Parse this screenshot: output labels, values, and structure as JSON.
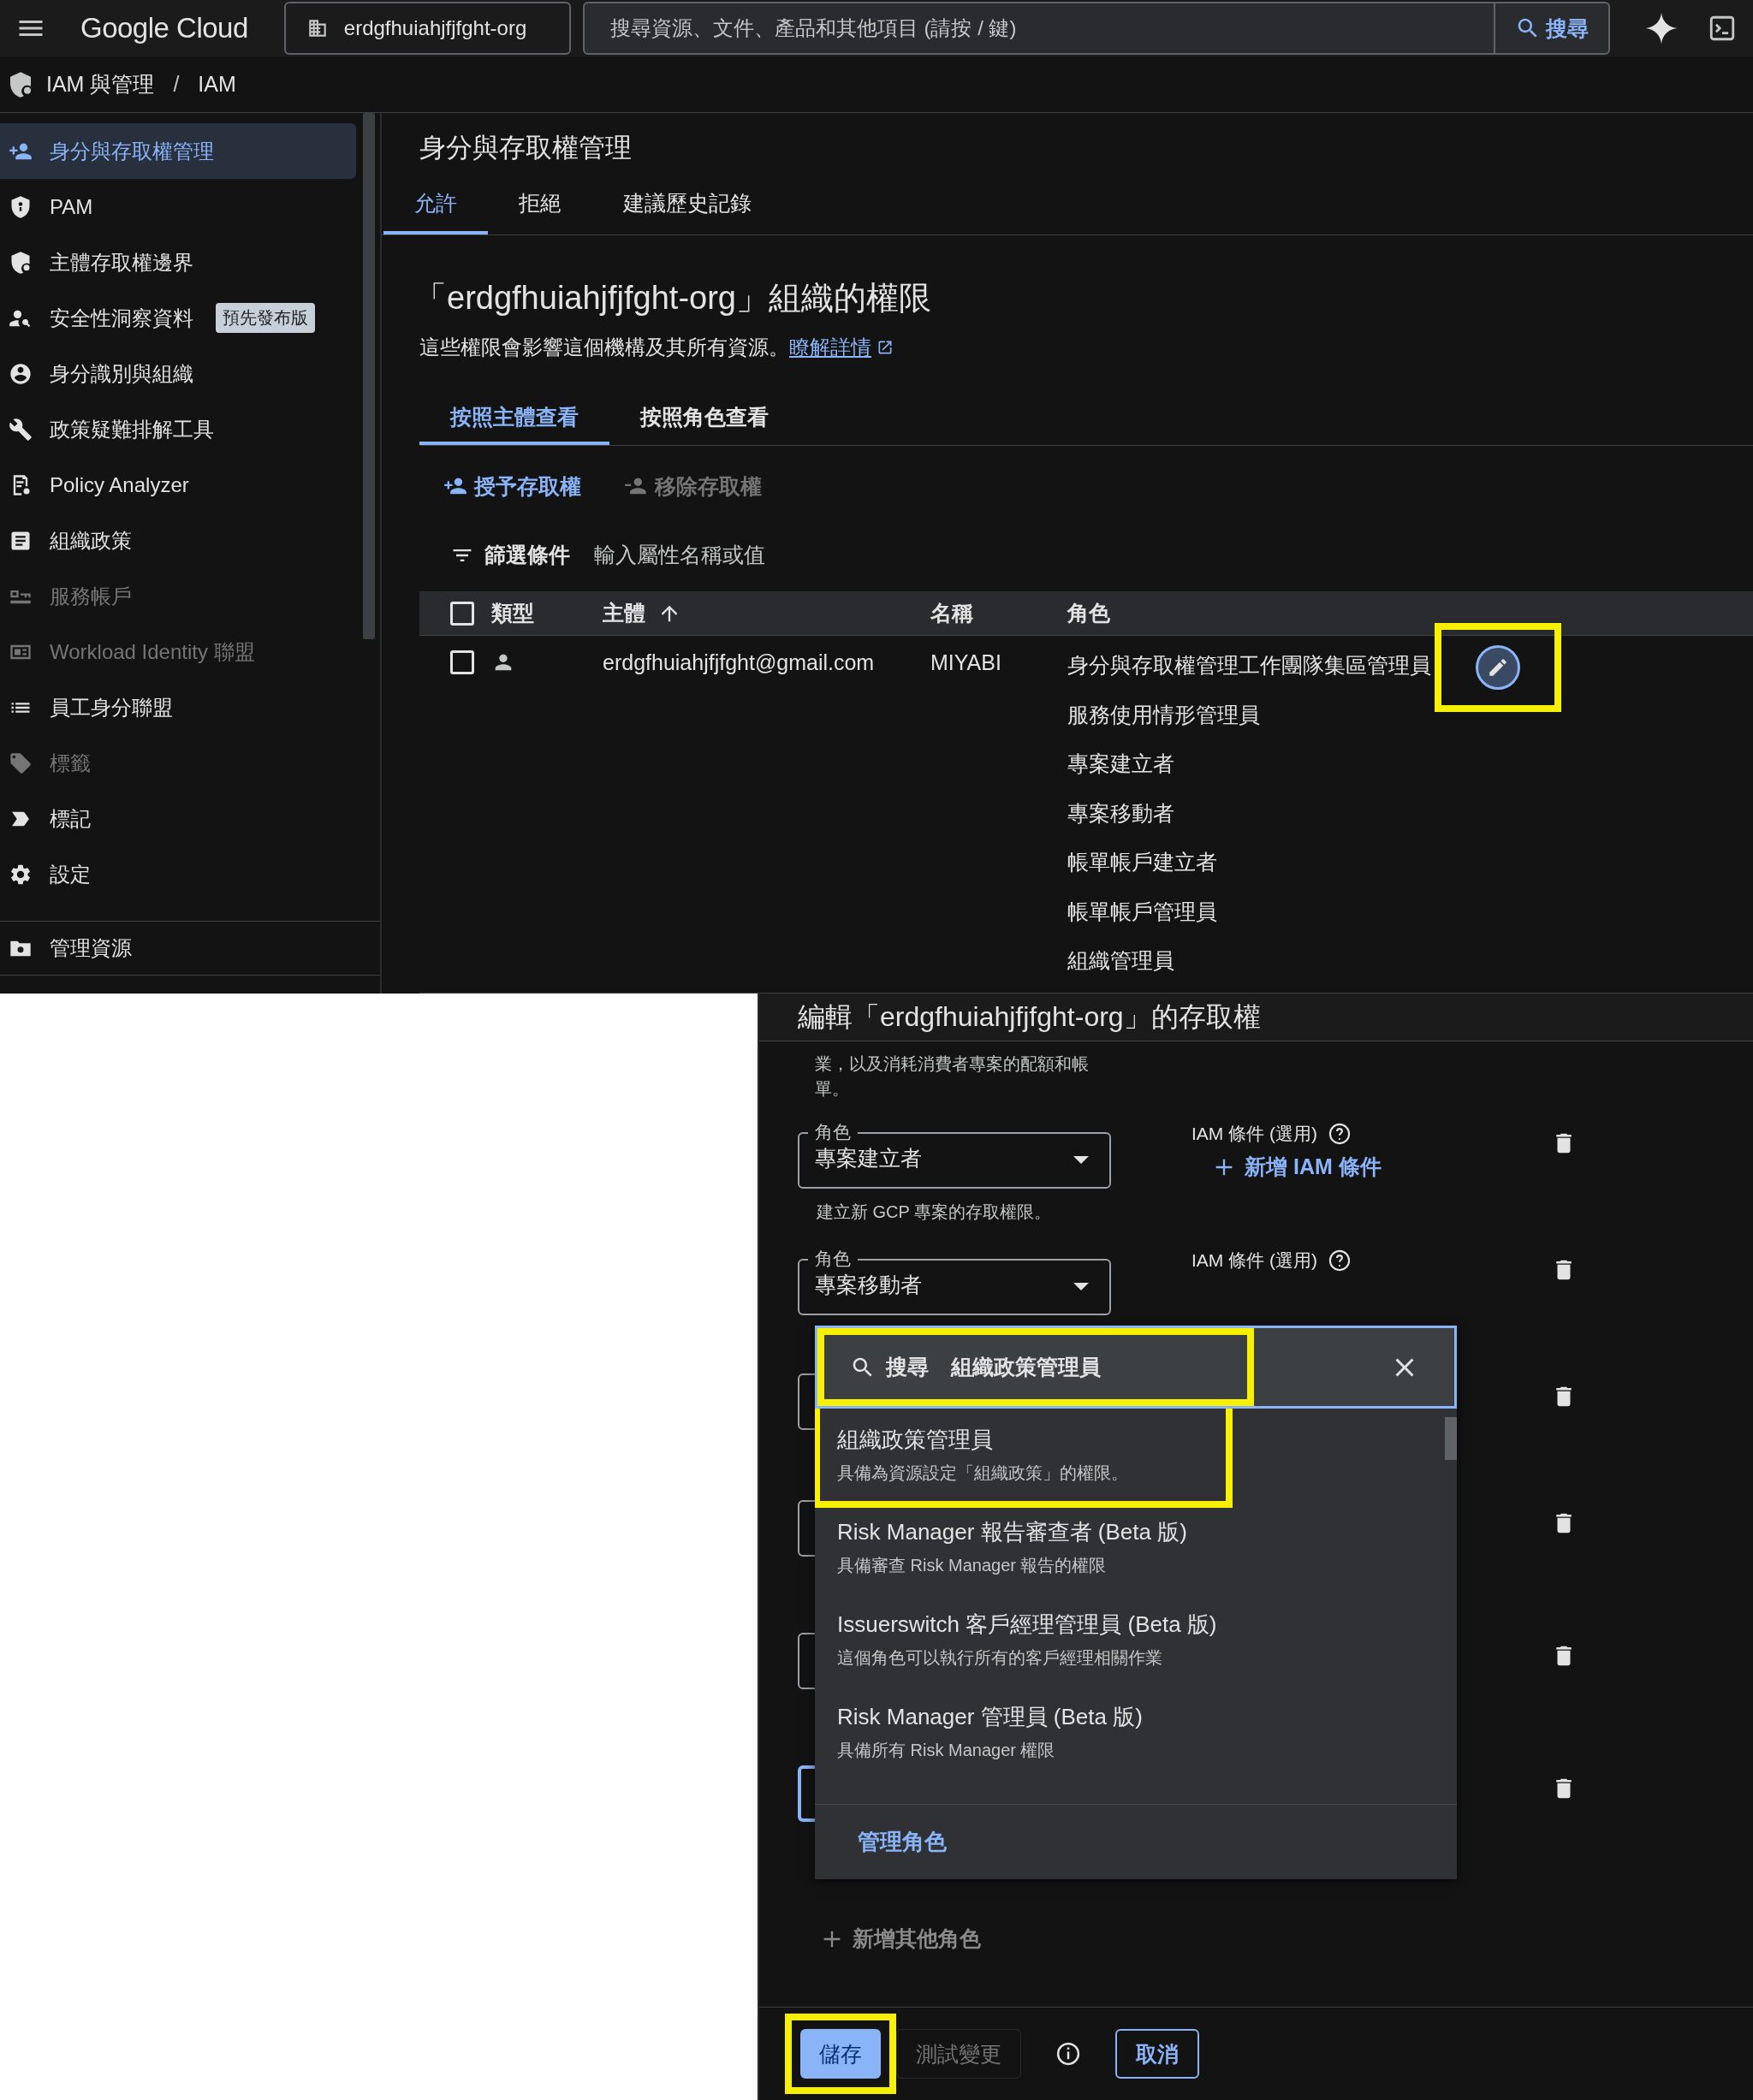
{
  "topbar": {
    "product": "Google Cloud",
    "project": "erdgfhuiahjfjfght-org",
    "search_placeholder": "搜尋資源、文件、產品和其他項目 (請按 / 鍵)",
    "search_button": "搜尋"
  },
  "breadcrumb": {
    "items": [
      "IAM 與管理",
      "IAM"
    ],
    "separator": "/"
  },
  "sidebar": {
    "items": [
      {
        "label": "身分與存取權管理",
        "selected": true,
        "disabled": false
      },
      {
        "label": "PAM",
        "selected": false,
        "disabled": false
      },
      {
        "label": "主體存取權邊界",
        "selected": false,
        "disabled": false
      },
      {
        "label": "安全性洞察資料",
        "selected": false,
        "disabled": false,
        "badge": "預先發布版"
      },
      {
        "label": "身分識別與組織",
        "selected": false,
        "disabled": false
      },
      {
        "label": "政策疑難排解工具",
        "selected": false,
        "disabled": false
      },
      {
        "label": "Policy Analyzer",
        "selected": false,
        "disabled": false
      },
      {
        "label": "組織政策",
        "selected": false,
        "disabled": false
      },
      {
        "label": "服務帳戶",
        "selected": false,
        "disabled": true
      },
      {
        "label": "Workload Identity 聯盟",
        "selected": false,
        "disabled": true
      },
      {
        "label": "員工身分聯盟",
        "selected": false,
        "disabled": false
      },
      {
        "label": "標籤",
        "selected": false,
        "disabled": true
      },
      {
        "label": "標記",
        "selected": false,
        "disabled": false
      },
      {
        "label": "設定",
        "selected": false,
        "disabled": false
      }
    ],
    "footer": "管理資源"
  },
  "page": {
    "title": "身分與存取權管理",
    "tabs": [
      {
        "label": "允許",
        "selected": true
      },
      {
        "label": "拒絕",
        "selected": false
      },
      {
        "label": "建議歷史記錄",
        "selected": false
      }
    ],
    "heading": "「erdgfhuiahjfjfght-org」組織的權限",
    "description": "這些權限會影響這個機構及其所有資源。",
    "learn_more": "瞭解詳情",
    "view_tabs": [
      {
        "label": "按照主體查看",
        "selected": true
      },
      {
        "label": "按照角色查看",
        "selected": false
      }
    ],
    "actions": [
      {
        "label": "授予存取權",
        "disabled": false
      },
      {
        "label": "移除存取權",
        "disabled": true
      }
    ],
    "filter": {
      "label": "篩選條件",
      "placeholder": "輸入屬性名稱或值"
    },
    "table": {
      "select_all_checked": false,
      "columns": [
        {
          "label": "類型",
          "sorted": false
        },
        {
          "label": "主體",
          "sorted": true
        },
        {
          "label": "名稱",
          "sorted": false
        },
        {
          "label": "角色",
          "sorted": false
        }
      ],
      "rows": [
        {
          "checked": false,
          "principal": "erdgfhuiahjfjfght@gmail.com",
          "name": "MIYABI",
          "edit_highlighted": true,
          "roles": [
            "身分與存取權管理工作團隊集區管理員",
            "服務使用情形管理員",
            "專案建立者",
            "專案移動者",
            "帳單帳戶建立者",
            "帳單帳戶管理員",
            "組織管理員"
          ]
        }
      ]
    }
  },
  "panel": {
    "title": "編輯「erdgfhuiahjfjfght-org」的存取權",
    "intro": "業，以及消耗消費者專案的配額和帳單。",
    "role_rows": [
      {
        "kind": "field",
        "focused": false,
        "label": "角色",
        "value": "專案建立者",
        "helper": "建立新 GCP 專案的存取權限。",
        "condition_label": "IAM 條件 (選用)",
        "add_condition": "新增 IAM 條件"
      },
      {
        "kind": "field",
        "focused": false,
        "label": "角色",
        "value": "專案移動者",
        "condition_label": "IAM 條件 (選用)"
      },
      {
        "kind": "covered",
        "focused": false
      },
      {
        "kind": "covered",
        "focused": false
      },
      {
        "kind": "covered",
        "focused": false
      },
      {
        "kind": "covered",
        "focused": true
      }
    ],
    "dropdown": {
      "search_label": "搜尋",
      "search_value": "組織政策管理員",
      "search_highlighted": true,
      "options": [
        {
          "title": "組織政策管理員",
          "description": "具備為資源設定「組織政策」的權限。",
          "highlighted": true
        },
        {
          "title": "Risk Manager 報告審查者 (Beta 版)",
          "description": "具備審查 Risk Manager 報告的權限",
          "highlighted": false
        },
        {
          "title": "Issuerswitch 客戶經理管理員 (Beta 版)",
          "description": "這個角色可以執行所有的客戶經理相關作業",
          "highlighted": false
        },
        {
          "title": "Risk Manager 管理員 (Beta 版)",
          "description": "具備所有 Risk Manager 權限",
          "highlighted": false
        }
      ],
      "footer": "管理角色"
    },
    "add_role": "新增其他角色",
    "buttons": [
      {
        "kind": "primary",
        "label": "儲存",
        "highlighted": true
      },
      {
        "kind": "disabled",
        "label": "測試變更",
        "highlighted": false
      },
      {
        "kind": "info"
      },
      {
        "kind": "outlined",
        "label": "取消",
        "highlighted": false
      }
    ]
  }
}
